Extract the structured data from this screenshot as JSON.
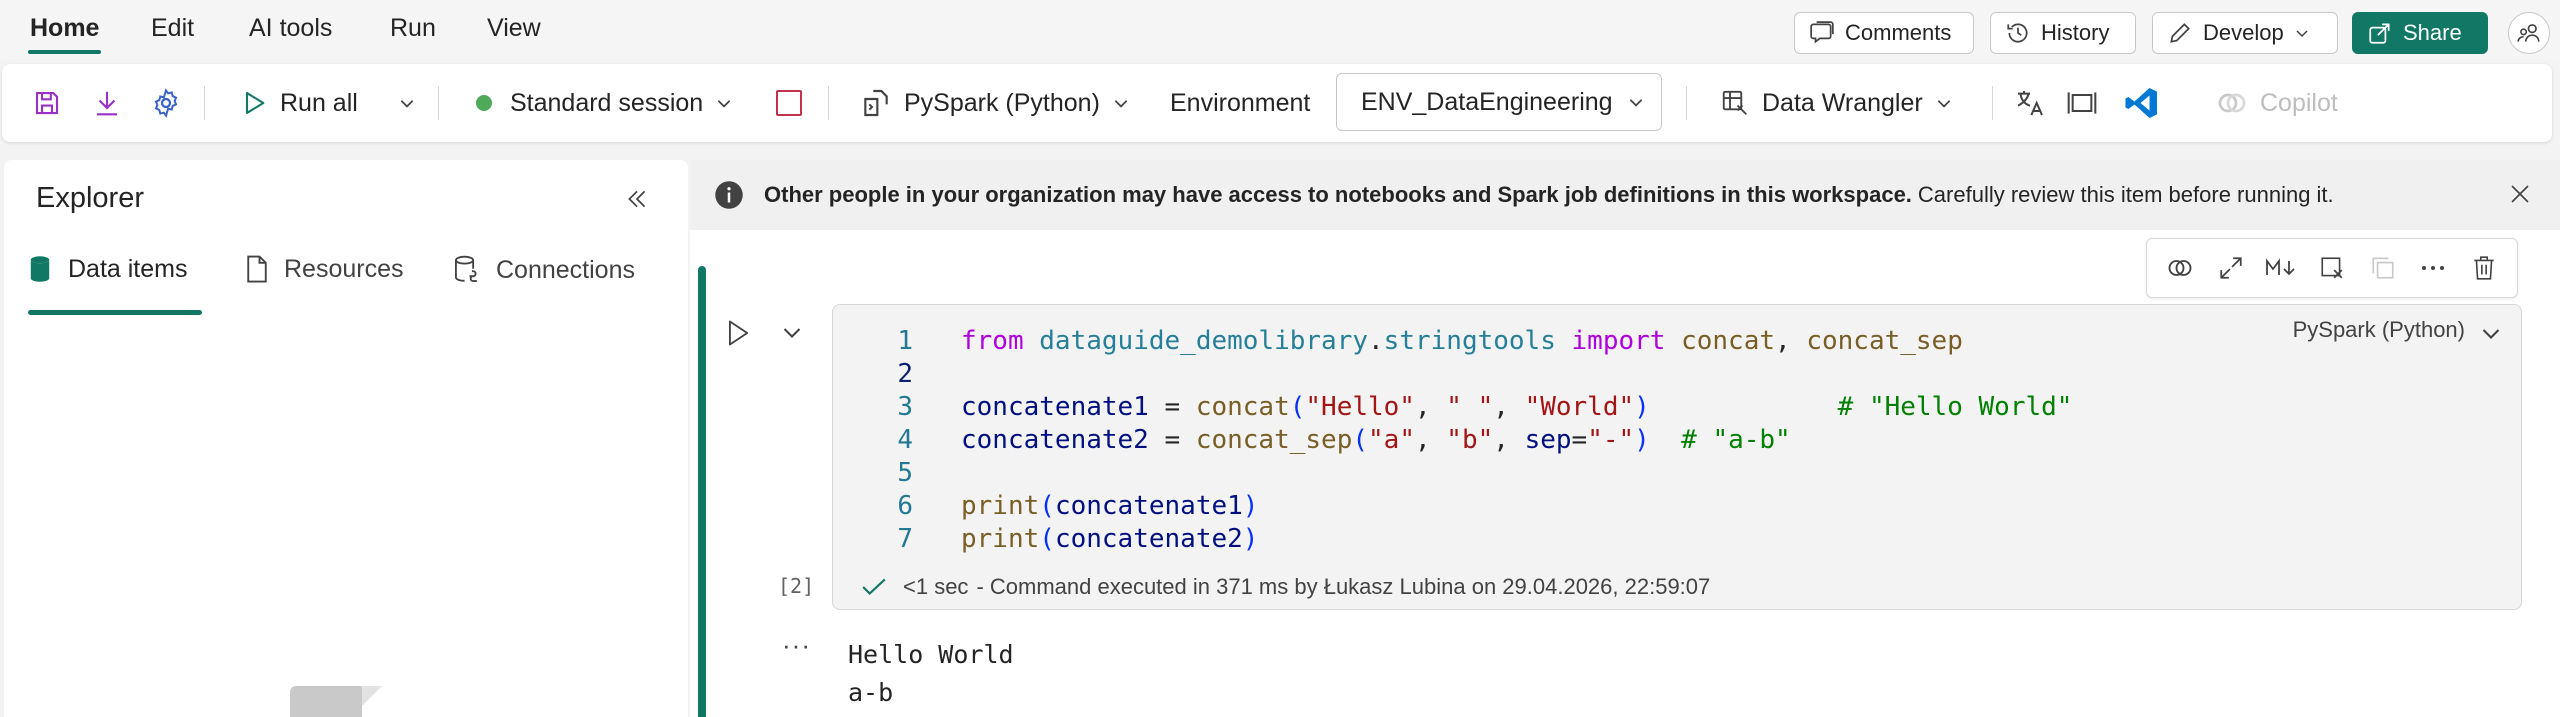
{
  "menu": {
    "tabs": [
      {
        "label": "Home",
        "active": true
      },
      {
        "label": "Edit"
      },
      {
        "label": "AI tools"
      },
      {
        "label": "Run"
      },
      {
        "label": "View"
      }
    ],
    "comments_label": "Comments",
    "history_label": "History",
    "develop_label": "Develop",
    "share_label": "Share"
  },
  "toolbar": {
    "run_all_label": "Run all",
    "session_label": "Standard session",
    "language_label": "PySpark (Python)",
    "environment_label": "Environment",
    "environment_value": "ENV_DataEngineering",
    "data_wrangler_label": "Data Wrangler",
    "copilot_label": "Copilot"
  },
  "explorer": {
    "title": "Explorer",
    "tabs": [
      {
        "label": "Data items",
        "active": true
      },
      {
        "label": "Resources"
      },
      {
        "label": "Connections"
      }
    ]
  },
  "info_bar": {
    "bold_text": "Other people in your organization may have access to notebooks and Spark job definitions in this workspace.",
    "text": "Carefully review this item before running it."
  },
  "cell": {
    "execution_count": "[2]",
    "code_lines": [
      "from dataguide_demolibrary.stringtools import concat, concat_sep",
      "",
      "concatenate1 = concat(\"Hello\", \" \", \"World\")            # \"Hello World\"",
      "concatenate2 = concat_sep(\"a\", \"b\", sep=\"-\")  # \"a-b\"",
      "",
      "print(concatenate1)",
      "print(concatenate2)"
    ],
    "line_numbers": [
      "1",
      "2",
      "3",
      "4",
      "5",
      "6",
      "7"
    ],
    "status_duration": "<1 sec",
    "status_text": "- Command executed in 371 ms by Łukasz Lubina on 29.04.2026, 22:59:07",
    "language": "PySpark (Python)",
    "output_lines": [
      "Hello World",
      "a-b"
    ]
  },
  "colors": {
    "accent": "#117865",
    "session_dot": "#4fa95a",
    "vscode_blue": "#0078d4"
  }
}
